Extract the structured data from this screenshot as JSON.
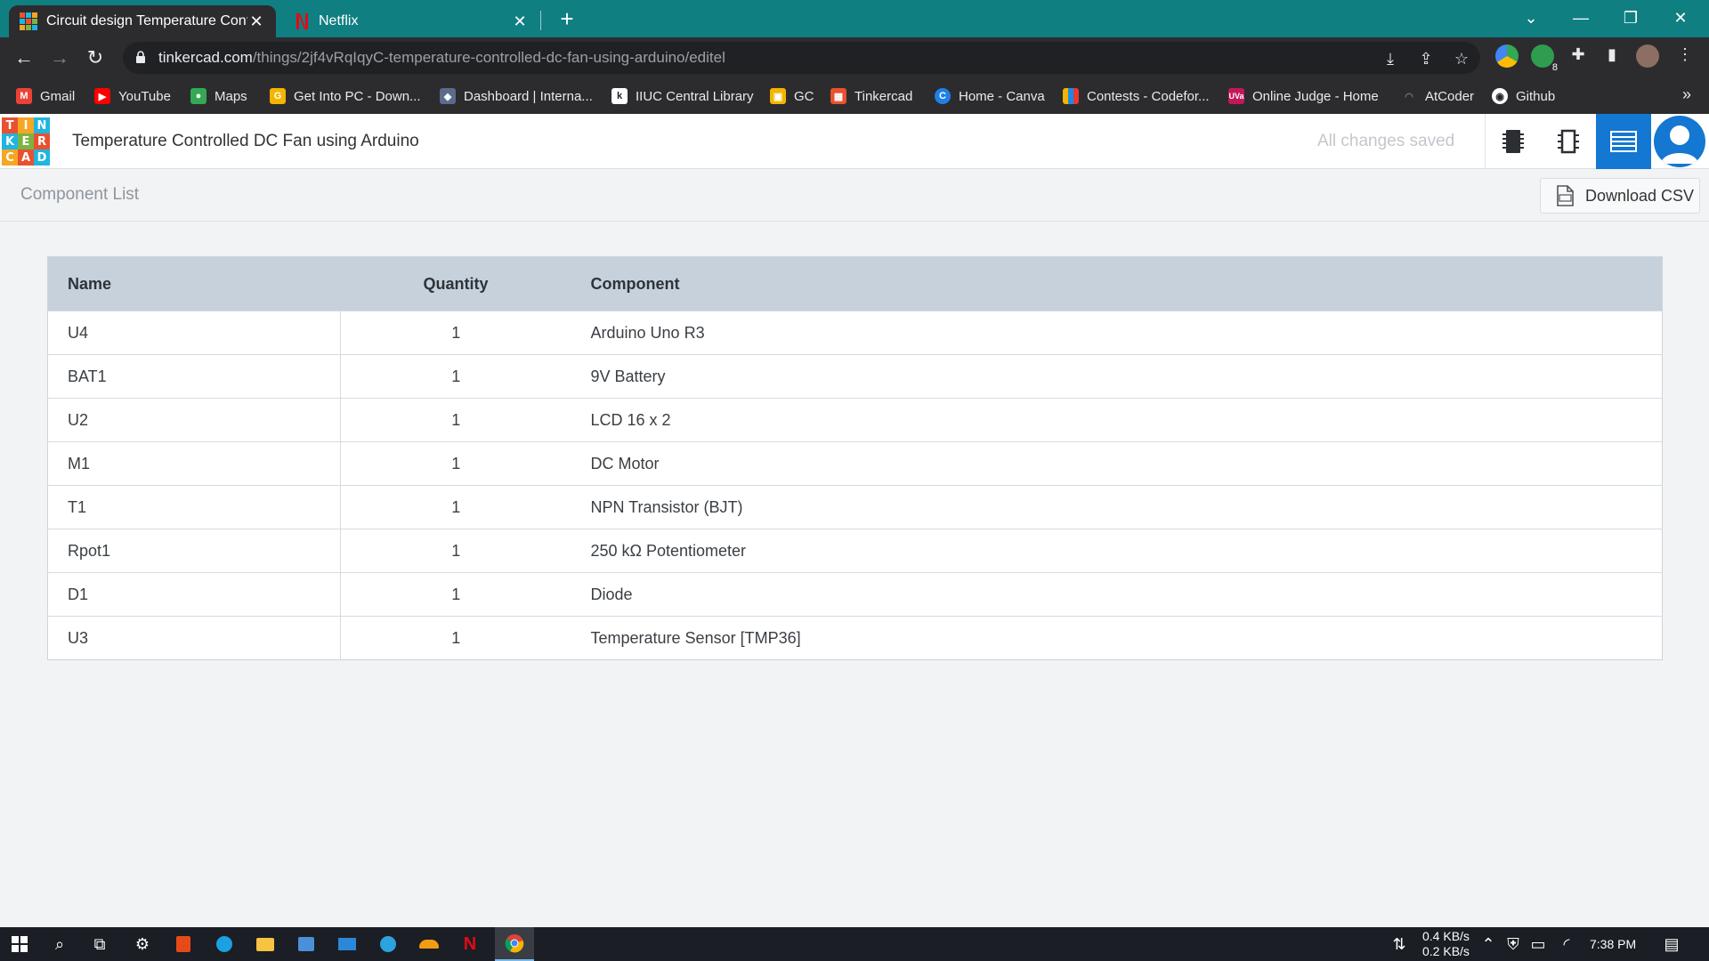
{
  "browser": {
    "tabs": [
      {
        "title": "Circuit design Temperature Conti",
        "icon": "tinkercad-favicon",
        "active": true
      },
      {
        "title": "Netflix",
        "icon": "netflix-favicon",
        "active": false
      }
    ],
    "url_host": "tinkercad.com",
    "url_path": "/things/2jf4vRqIqyC-temperature-controlled-dc-fan-using-arduino/editel",
    "bookmarks": [
      {
        "label": "Gmail",
        "icon": "gmail-icon",
        "color": "#ea4335"
      },
      {
        "label": "YouTube",
        "icon": "youtube-icon",
        "color": "#ff0000"
      },
      {
        "label": "Maps",
        "icon": "maps-icon",
        "color": "#34a853"
      },
      {
        "label": "Get Into PC - Down...",
        "icon": "getintopc-icon",
        "color": "#f4b400"
      },
      {
        "label": "Dashboard | Interna...",
        "icon": "iiuc-icon",
        "color": "#5b6b8c"
      },
      {
        "label": "IIUC Central Library",
        "icon": "koha-icon",
        "color": "#ffffff"
      },
      {
        "label": "GC",
        "icon": "classroom-icon",
        "color": "#f4b400"
      },
      {
        "label": "Tinkercad",
        "icon": "tinkercad-icon",
        "color": "#e8512f"
      },
      {
        "label": "Home - Canva",
        "icon": "canva-icon",
        "color": "#1e7fe6"
      },
      {
        "label": "Contests - Codefor...",
        "icon": "codeforces-icon",
        "color": "#f4b400"
      },
      {
        "label": "Online Judge - Home",
        "icon": "uva-icon",
        "color": "#c2185b"
      },
      {
        "label": "AtCoder",
        "icon": "atcoder-icon",
        "color": "#555555"
      },
      {
        "label": "Github",
        "icon": "github-icon",
        "color": "#ffffff"
      }
    ]
  },
  "header": {
    "logo_letters": [
      "T",
      "I",
      "N",
      "K",
      "E",
      "R",
      "C",
      "A",
      "D"
    ],
    "project_title": "Temperature Controlled DC Fan using Arduino",
    "save_status": "All changes saved"
  },
  "subheader": {
    "title": "Component List",
    "download_label": "Download CSV"
  },
  "table": {
    "columns": [
      "Name",
      "Quantity",
      "Component"
    ],
    "rows": [
      {
        "name": "U4",
        "quantity": "1",
        "component": "Arduino Uno R3"
      },
      {
        "name": "BAT1",
        "quantity": "1",
        "component": "9V Battery"
      },
      {
        "name": "U2",
        "quantity": "1",
        "component": "LCD 16 x 2"
      },
      {
        "name": "M1",
        "quantity": "1",
        "component": "DC Motor"
      },
      {
        "name": "T1",
        "quantity": "1",
        "component": "NPN Transistor (BJT)"
      },
      {
        "name": "Rpot1",
        "quantity": "1",
        "component": "250 kΩ Potentiometer"
      },
      {
        "name": "D1",
        "quantity": "1",
        "component": "Diode"
      },
      {
        "name": "U3",
        "quantity": "1",
        "component": "Temperature Sensor [TMP36]"
      }
    ]
  },
  "taskbar": {
    "net_down": "0.4 KB/s",
    "net_up": "0.2 KB/s",
    "time": "7:38 PM",
    "extension_badge": "8"
  },
  "colors": {
    "chrome_frame": "#0f7f82",
    "accent": "#1477d1",
    "table_header": "#c7d1db"
  }
}
